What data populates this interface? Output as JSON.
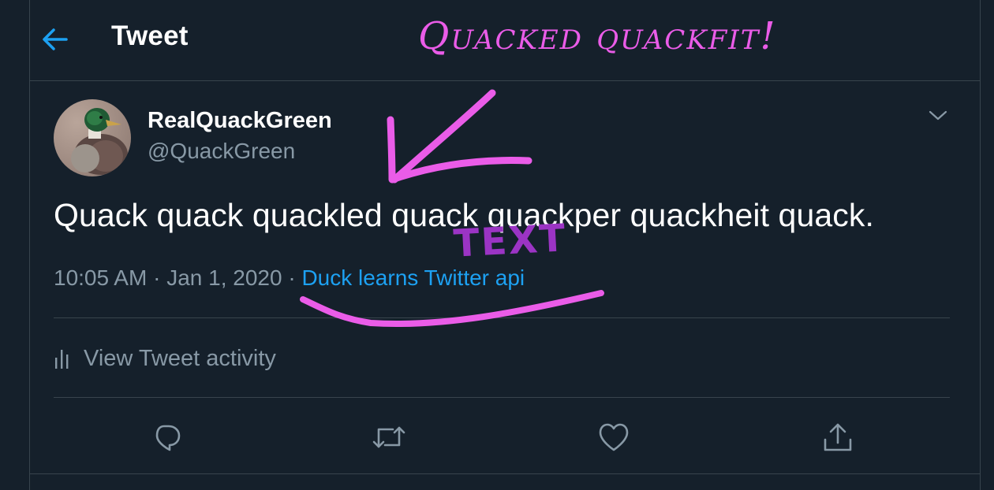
{
  "header": {
    "title": "Tweet",
    "back_icon": "arrow-left-icon"
  },
  "annotations": {
    "title": "Quacked quackfit!",
    "text_label": "TEXT",
    "color_pink": "#ea5ce8",
    "color_purple": "#9b34c4"
  },
  "tweet": {
    "author_name": "RealQuackGreen",
    "author_handle": "@QuackGreen",
    "text": "Quack quack quackled quack quackper quackheit quack.",
    "time": "10:05 AM",
    "separator": "·",
    "date": "Jan 1, 2020",
    "source": "Duck learns Twitter api"
  },
  "activity": {
    "label": "View Tweet activity",
    "icon": "bar-chart-icon"
  },
  "actions": [
    {
      "icon": "reply-icon"
    },
    {
      "icon": "retweet-icon"
    },
    {
      "icon": "like-icon"
    },
    {
      "icon": "share-icon"
    }
  ],
  "colors": {
    "background": "#15202b",
    "border": "#38444d",
    "accent": "#1da1f2",
    "secondary_text": "#8899a6"
  }
}
